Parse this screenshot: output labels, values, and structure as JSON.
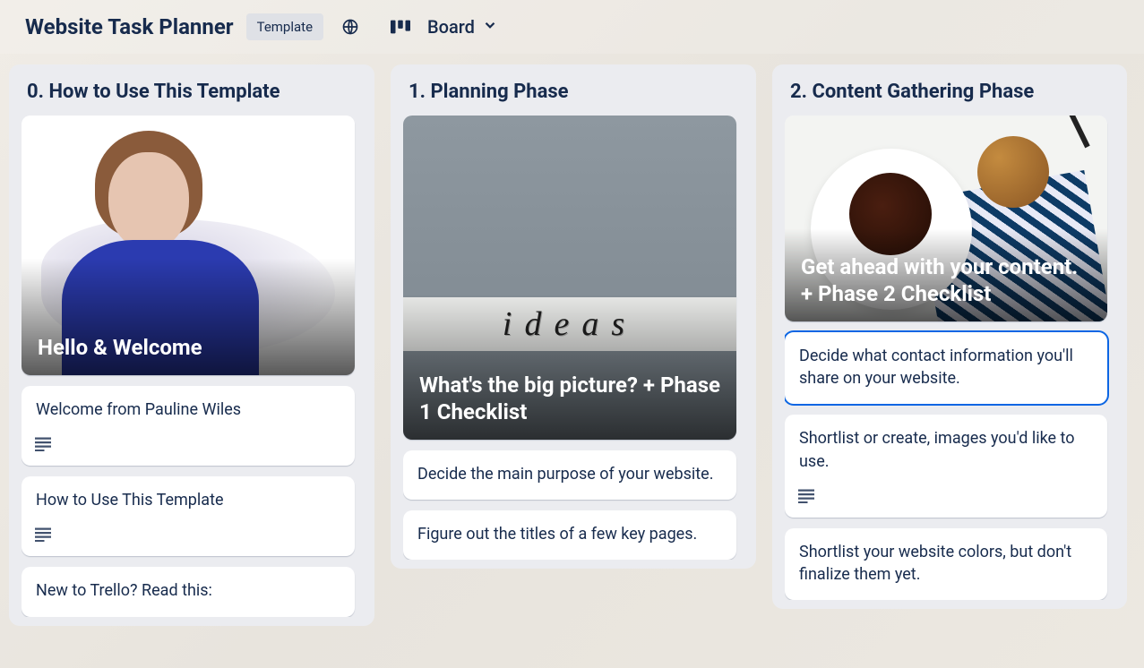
{
  "header": {
    "title": "Website Task Planner",
    "badge": "Template",
    "view_label": "Board"
  },
  "lists": [
    {
      "title": "0. How to Use This Template",
      "cover": {
        "title": "Hello & Welcome",
        "scene": "person"
      },
      "cards": [
        {
          "text": "Welcome from Pauline Wiles",
          "has_description": true
        },
        {
          "text": "How to Use This Template",
          "has_description": true
        },
        {
          "text": "New to Trello? Read this:"
        }
      ]
    },
    {
      "title": "1. Planning Phase",
      "cover": {
        "title": "What's the big picture? + Phase 1 Checklist",
        "scene": "ideas",
        "tall": true,
        "word": "ideas"
      },
      "cards": [
        {
          "text": "Decide the main purpose of your website."
        },
        {
          "text": "Figure out the titles of a few key pages."
        }
      ]
    },
    {
      "title": "2. Content Gathering Phase",
      "cover": {
        "title": "Get ahead with your content. + Phase 2 Checklist",
        "scene": "coffee",
        "short": true
      },
      "cards": [
        {
          "text": "Decide what contact information you'll share on your website.",
          "selected": true
        },
        {
          "text": "Shortlist or create, images you'd like to use.",
          "has_description": true
        },
        {
          "text": "Shortlist your website colors, but don't finalize them yet."
        }
      ]
    }
  ]
}
